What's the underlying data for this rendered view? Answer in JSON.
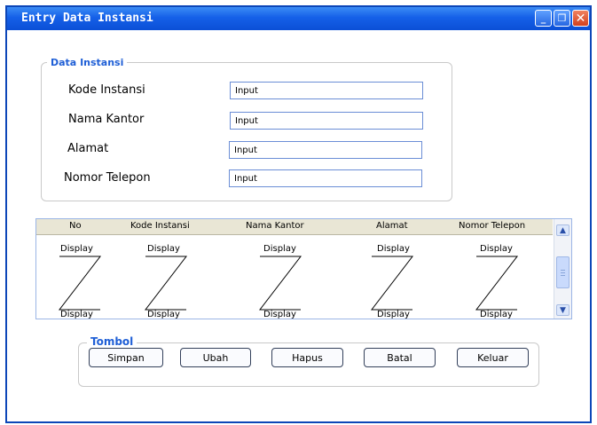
{
  "window": {
    "title": "Entry Data Instansi",
    "controls": {
      "minimize_glyph": "_",
      "maximize_glyph": "❐",
      "close_glyph": "✕"
    }
  },
  "form_group": {
    "legend": "Data Instansi",
    "fields": [
      {
        "label": "Kode Instansi",
        "value": "Input"
      },
      {
        "label": "Nama Kantor",
        "value": "Input"
      },
      {
        "label": "Alamat",
        "value": "Input"
      },
      {
        "label": "Nomor Telepon",
        "value": "Input"
      }
    ]
  },
  "table": {
    "columns": [
      "No",
      "Kode Instansi",
      "Nama Kantor",
      "Alamat",
      "Nomor Telepon"
    ],
    "cell_top": "Display",
    "cell_bottom": "Display",
    "scroll_up_glyph": "▲",
    "scroll_down_glyph": "▼"
  },
  "button_group": {
    "legend": "Tombol",
    "buttons": [
      "Simpan",
      "Ubah",
      "Hapus",
      "Batal",
      "Keluar"
    ]
  },
  "colors": {
    "title_bar": "#1560e8",
    "legend_text": "#1f5fd6",
    "input_border": "#6b8ed6"
  }
}
